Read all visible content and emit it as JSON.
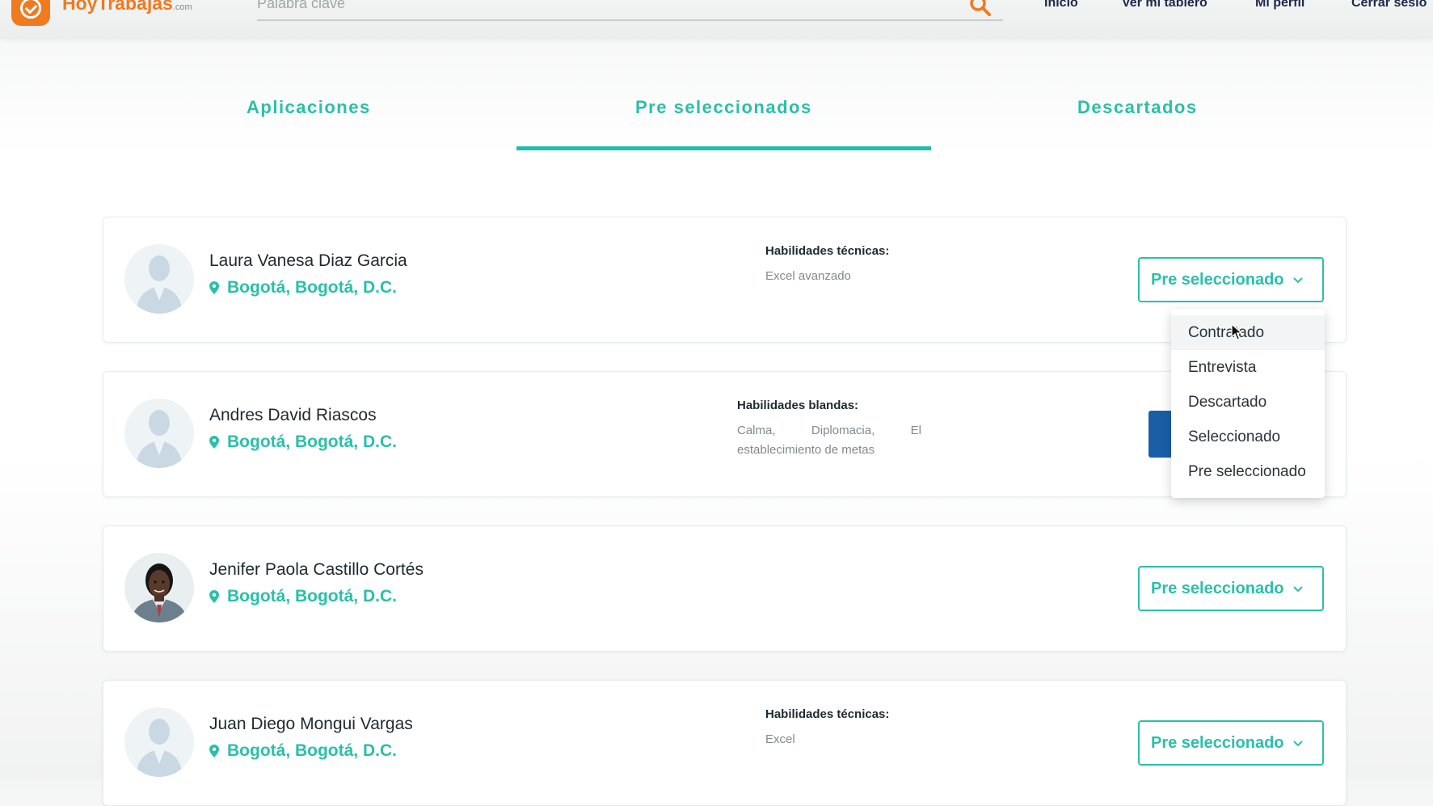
{
  "header": {
    "brand": "HoyTrabajas",
    "brand_suffix": ".com",
    "search_placeholder": "Palabra clave",
    "nav": [
      "Inicio",
      "Ver mi tablero",
      "Mi perfil",
      "Cerrar sesió"
    ]
  },
  "tabs": [
    {
      "label": "Aplicaciones",
      "active": false
    },
    {
      "label": "Pre seleccionados",
      "active": true
    },
    {
      "label": "Descartados",
      "active": false
    }
  ],
  "candidates": [
    {
      "name": "Laura Vanesa Diaz Garcia",
      "location": "Bogotá, Bogotá, D.C.",
      "skills_title": "Habilidades técnicas:",
      "skills_text": "Excel avanzado",
      "status": "Pre seleccionado",
      "avatar": "placeholder"
    },
    {
      "name": "Andres David Riascos",
      "location": "Bogotá, Bogotá, D.C.",
      "skills_title": "Habilidades blandas:",
      "skills_text": [
        "Calma, Diplomacia, El",
        "establecimiento de metas"
      ],
      "status": "",
      "avatar": "placeholder"
    },
    {
      "name": "Jenifer Paola Castillo Cortés",
      "location": "Bogotá, Bogotá, D.C.",
      "skills_title": "",
      "skills_text": "",
      "status": "Pre seleccionado",
      "avatar": "photo"
    },
    {
      "name": "Juan Diego Mongui Vargas",
      "location": "Bogotá, Bogotá, D.C.",
      "skills_title": "Habilidades técnicas:",
      "skills_text": "Excel",
      "status": "Pre seleccionado",
      "avatar": "placeholder"
    }
  ],
  "status_dropdown": {
    "open": true,
    "options": [
      "Contratado",
      "Entrevista",
      "Descartado",
      "Seleccionado",
      "Pre seleccionado"
    ],
    "hovered": "Contratado"
  },
  "colors": {
    "accent": "#2bbfaa",
    "brand_orange": "#f07a1e",
    "nav_text": "#1d2a4a",
    "button_blue": "#1a5ea8"
  }
}
